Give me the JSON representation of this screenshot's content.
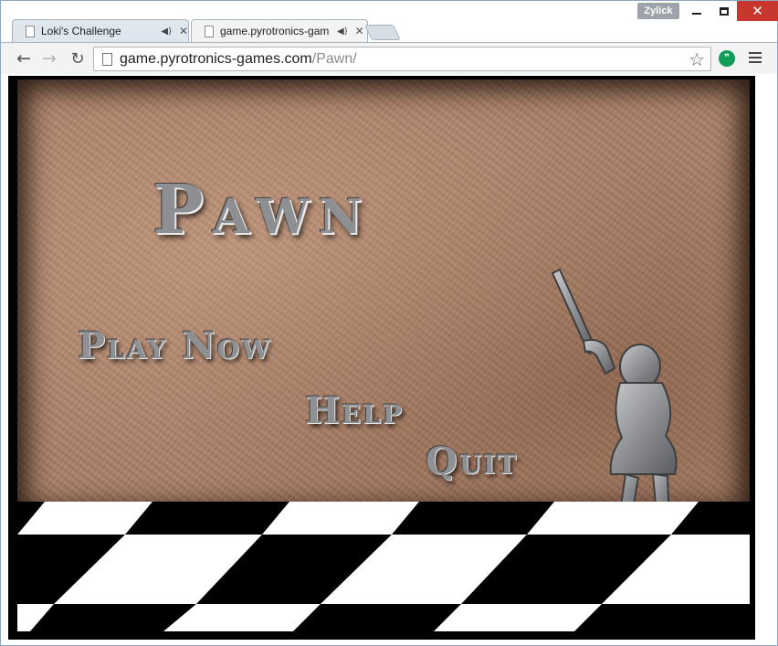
{
  "window": {
    "profile_name": "Zylick",
    "controls": {
      "minimize": "minimize",
      "maximize": "maximize",
      "close": "close"
    }
  },
  "tabs": [
    {
      "title": "Loki's Challenge",
      "active": false,
      "audio_icon": "speaker-icon"
    },
    {
      "title": "game.pyrotronics-gam",
      "active": true,
      "audio_icon": "speaker-icon"
    }
  ],
  "toolbar": {
    "url_host": "game.pyrotronics-games.com",
    "url_path": "/Pawn/",
    "icons": [
      "back-arrow-icon",
      "forward-arrow-icon",
      "reload-icon",
      "page-icon",
      "star-icon",
      "hangouts-icon",
      "menu-icon"
    ]
  },
  "game": {
    "title": "Pawn",
    "menu": {
      "play": "Play Now",
      "help": "Help",
      "quit": "Quit"
    }
  },
  "colors": {
    "stone": "#a97f66",
    "engraving": "#8d8f93",
    "close_button": "#c7372e",
    "hangouts": "#0f9d58"
  }
}
